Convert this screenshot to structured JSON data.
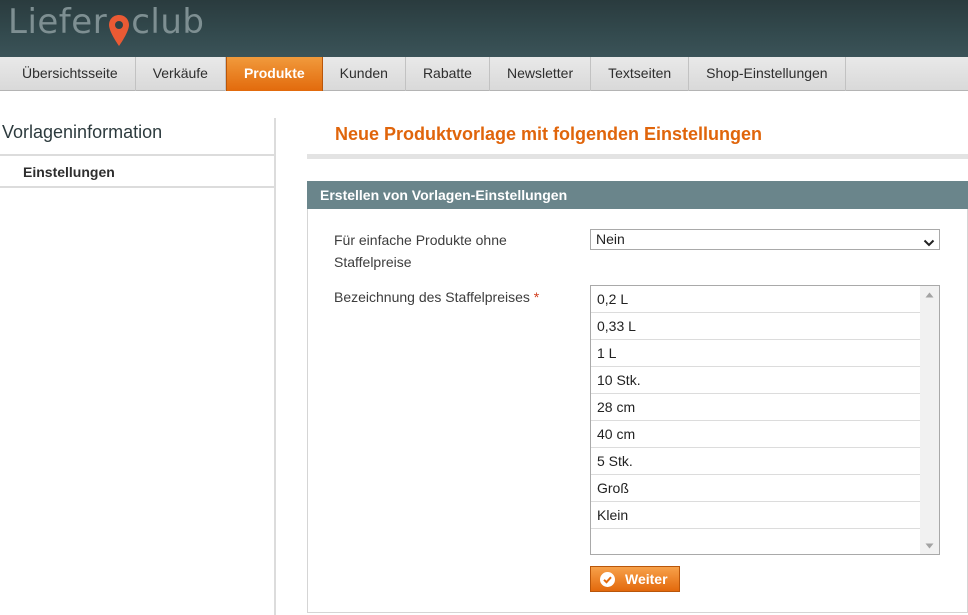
{
  "header": {
    "logo_part1": "Liefer",
    "logo_part2": "club"
  },
  "nav": {
    "items": [
      {
        "label": "Übersichtsseite"
      },
      {
        "label": "Verkäufe"
      },
      {
        "label": "Produkte"
      },
      {
        "label": "Kunden"
      },
      {
        "label": "Rabatte"
      },
      {
        "label": "Newsletter"
      },
      {
        "label": "Textseiten"
      },
      {
        "label": "Shop-Einstellungen"
      }
    ],
    "active_index": 2
  },
  "sidebar": {
    "title": "Vorlageninformation",
    "tab": "Einstellungen"
  },
  "main": {
    "page_title": "Neue Produktvorlage mit folgenden Einstellungen",
    "section_title": "Erstellen von Vorlagen-Einstellungen",
    "field1_label_line1": "Für einfache Produkte ohne",
    "field1_label_line2": "Staffelpreise",
    "field1_value": "Nein",
    "field2_label": "Bezeichnung des Staffelpreises",
    "required_mark": "*",
    "field2_options": [
      "0,2 L",
      "0,33 L",
      "1 L",
      "10 Stk.",
      "28 cm",
      "40 cm",
      "5 Stk.",
      "Groß",
      "Klein"
    ],
    "submit_label": "Weiter"
  },
  "colors": {
    "accent": "#e26a0c",
    "section_head": "#6a858b",
    "header_bg": "#334a4e"
  }
}
